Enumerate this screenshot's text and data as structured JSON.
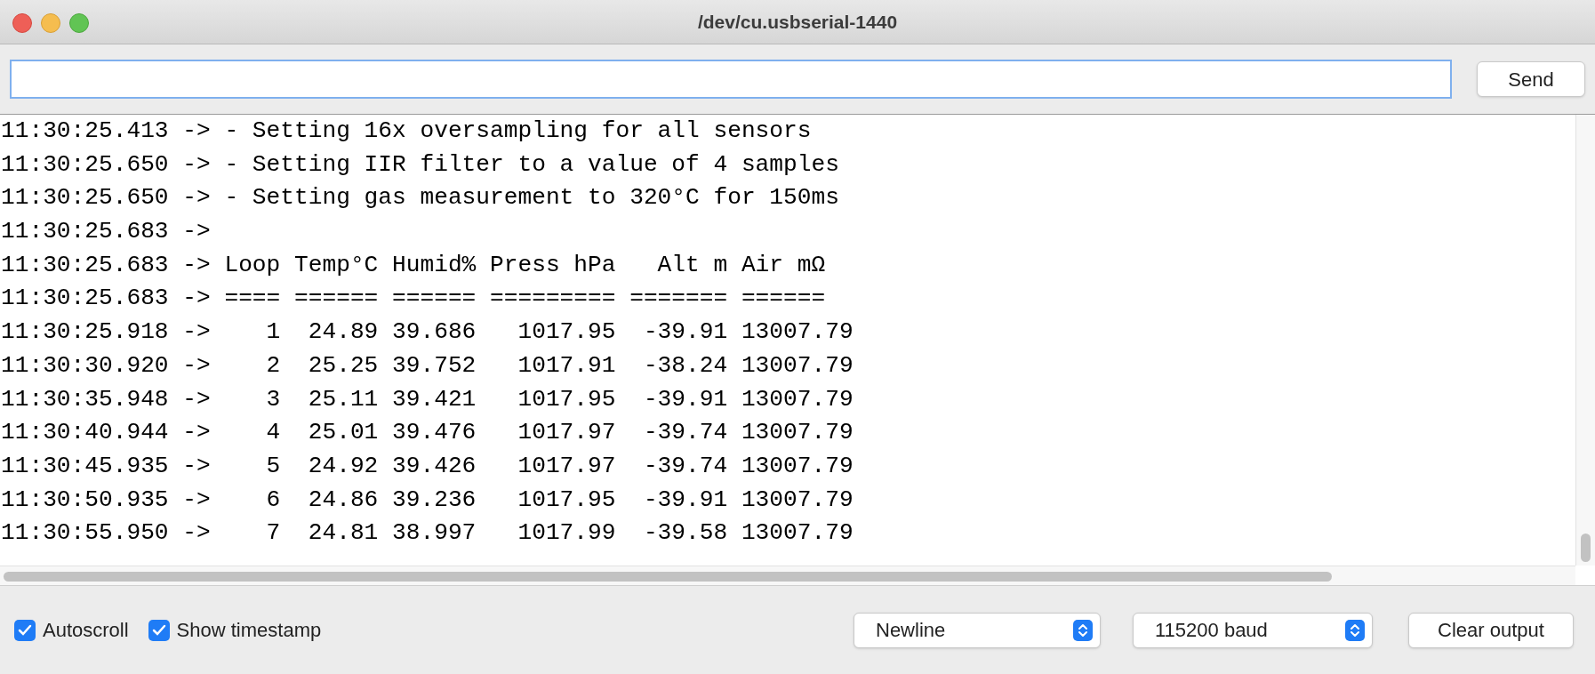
{
  "window": {
    "title": "/dev/cu.usbserial-1440"
  },
  "send_button": "Send",
  "output_lines": [
    "11:30:25.413 -> - Setting 16x oversampling for all sensors",
    "11:30:25.650 -> - Setting IIR filter to a value of 4 samples",
    "11:30:25.650 -> - Setting gas measurement to 320°C for 150ms",
    "11:30:25.683 ->",
    "11:30:25.683 -> Loop Temp°C Humid% Press hPa   Alt m Air mΩ",
    "11:30:25.683 -> ==== ====== ====== ========= ======= ======",
    "11:30:25.918 ->    1  24.89 39.686   1017.95  -39.91 13007.79",
    "11:30:30.920 ->    2  25.25 39.752   1017.91  -38.24 13007.79",
    "11:30:35.948 ->    3  25.11 39.421   1017.95  -39.91 13007.79",
    "11:30:40.944 ->    4  25.01 39.476   1017.97  -39.74 13007.79",
    "11:30:45.935 ->    5  24.92 39.426   1017.97  -39.74 13007.79",
    "11:30:50.935 ->    6  24.86 39.236   1017.95  -39.91 13007.79",
    "11:30:55.950 ->    7  24.81 38.997   1017.99  -39.58 13007.79"
  ],
  "options": [
    {
      "label": "Autoscroll",
      "checked": true
    },
    {
      "label": "Show timestamp",
      "checked": true
    }
  ],
  "line_ending": "Newline",
  "baud_rate": "115200 baud",
  "clear_button": "Clear output"
}
